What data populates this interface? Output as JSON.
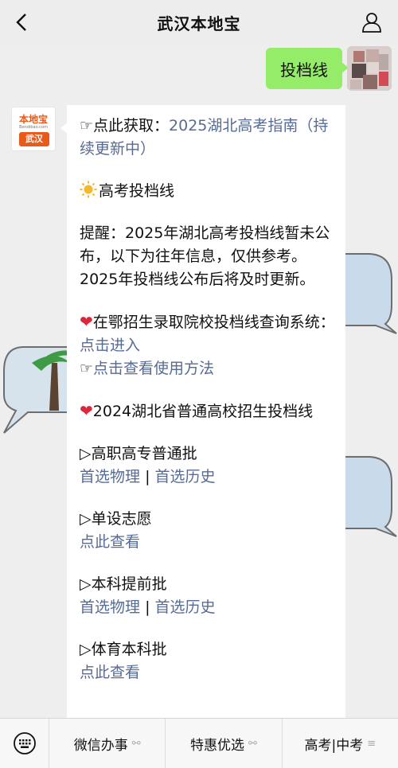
{
  "header": {
    "title": "武汉本地宝",
    "back_icon": "chevron-left-icon",
    "profile_icon": "person-icon"
  },
  "outgoing": {
    "text": "投档线"
  },
  "avatar": {
    "brand": "本地宝",
    "site": "Bendibao.com",
    "city": "武汉"
  },
  "message": {
    "line1_prefix": "☞点此获取：",
    "line1_link": "2025湖北高考指南（持续更新中）",
    "section_title": "高考投档线",
    "reminder": "提醒：2025年湖北高考投档线暂未公布，以下为往年信息，仅供参考。2025年投档线公布后将及时更新。",
    "query_text": "在鄂招生录取院校投档线查询系统：",
    "query_link": "点击进入",
    "howto_prefix": "☞",
    "howto_link": "点击查看使用方法",
    "year_title": "2024湖北省普通高校招生投档线",
    "sections": [
      {
        "title": "▷高职高专普通批",
        "links": [
          "首选物理",
          "首选历史"
        ]
      },
      {
        "title": "▷单设志愿",
        "links": [
          "点此查看"
        ]
      },
      {
        "title": "▷本科提前批",
        "links": [
          "首选物理",
          "首选历史"
        ]
      },
      {
        "title": "▷体育本科批",
        "links": [
          "点此查看"
        ]
      }
    ],
    "separator": "|"
  },
  "bottom_menu": {
    "keyboard_icon": "keyboard-icon",
    "items": [
      "微信办事",
      "特惠优选",
      "高考|中考"
    ],
    "link_icon": "link-icon",
    "list_icon": "menu-lines-icon"
  },
  "colors": {
    "bubble_green": "#95ec69",
    "link_blue": "#576b95",
    "heart_red": "#e0243a",
    "brand_orange": "#e8591a"
  }
}
